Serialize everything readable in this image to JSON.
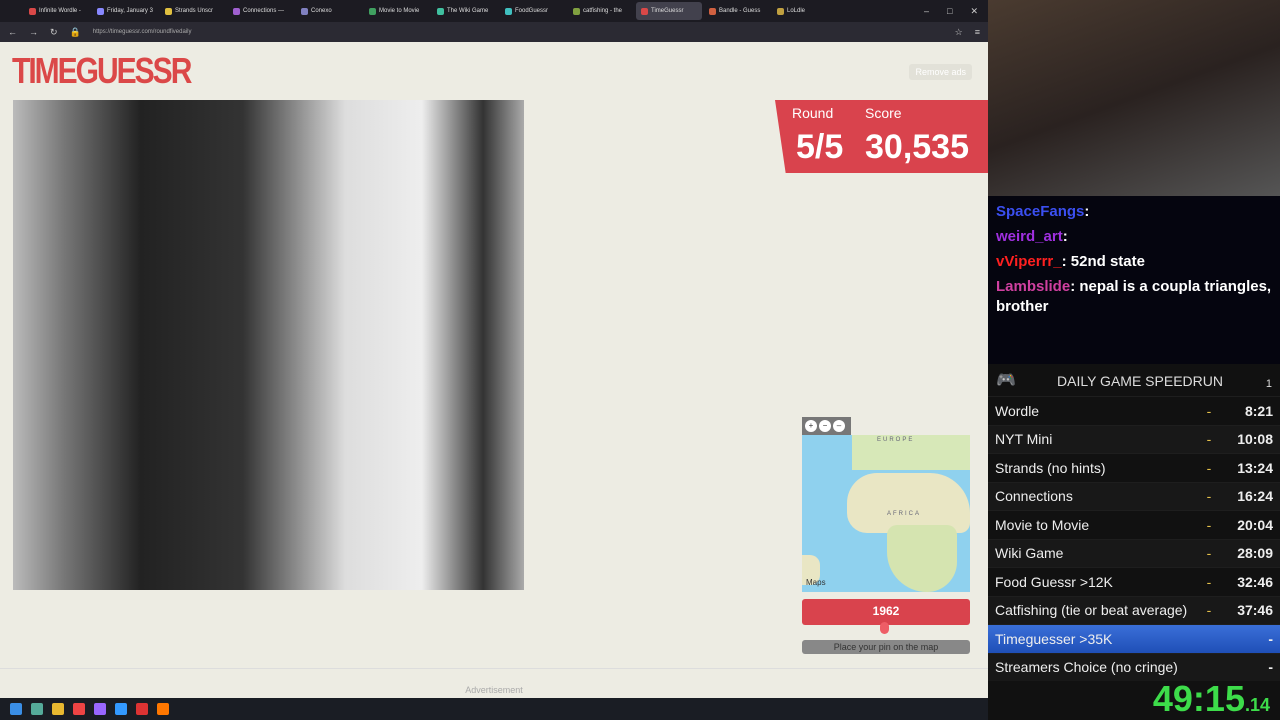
{
  "browser": {
    "tabs": [
      {
        "label": "Infinite Wordle -",
        "color": "#d94848"
      },
      {
        "label": "Friday, January 3",
        "color": "#8888ff"
      },
      {
        "label": "Strands Unscr",
        "color": "#e0c040"
      },
      {
        "label": "Connections —",
        "color": "#a060d0"
      },
      {
        "label": "Conexo",
        "color": "#8080c0"
      },
      {
        "label": "Movie to Movie",
        "color": "#40a060"
      },
      {
        "label": "The Wiki Game",
        "color": "#40c0a0"
      },
      {
        "label": "FoodGuessr",
        "color": "#40c0c0"
      },
      {
        "label": "catfishing - the",
        "color": "#80a040"
      },
      {
        "label": "TimeGuessr",
        "color": "#d94848",
        "active": true
      },
      {
        "label": "Bandle - Guess",
        "color": "#d06040"
      },
      {
        "label": "LoLdle",
        "color": "#c0a040"
      }
    ],
    "url": "https://timeguessr.com/roundfivedaily"
  },
  "page": {
    "logo": "TIMEGUESSR",
    "remove_ads": "Remove ads",
    "round_label": "Round",
    "round_value": "5/5",
    "score_label": "Score",
    "score_value": "30,535",
    "map_labels": {
      "europe": "EUROPE",
      "africa": "AFRICA",
      "attribution": "Maps"
    },
    "year": "1962",
    "place_pin": "Place your pin on the map",
    "advertisement": "Advertisement",
    "accent": "#d9434d"
  },
  "chat": [
    {
      "user": "SpaceFangs",
      "color": "#3b4ff0",
      "message": ""
    },
    {
      "user": "weird_art",
      "color": "#a030e0",
      "message": ""
    },
    {
      "user": "vViperrr_",
      "color": "#ff2020",
      "message": "52nd state"
    },
    {
      "user": "Lambslide",
      "color": "#d040a0",
      "message": "nepal is a coupla triangles, brother"
    }
  ],
  "splits": {
    "title": "DAILY GAME SPEEDRUN",
    "attempts": "1",
    "rows": [
      {
        "name": "Wordle",
        "delta": "-",
        "time": "8:21"
      },
      {
        "name": "NYT Mini",
        "delta": "-",
        "time": "10:08"
      },
      {
        "name": "Strands (no hints)",
        "delta": "-",
        "time": "13:24"
      },
      {
        "name": "Connections",
        "delta": "-",
        "time": "16:24"
      },
      {
        "name": "Movie to Movie",
        "delta": "-",
        "time": "20:04"
      },
      {
        "name": "Wiki Game",
        "delta": "-",
        "time": "28:09"
      },
      {
        "name": "Food Guessr >12K",
        "delta": "-",
        "time": "32:46"
      },
      {
        "name": "Catfishing (tie or beat average)",
        "delta": "-",
        "time": "37:46"
      },
      {
        "name": "Timeguesser >35K",
        "delta": "",
        "time": "-",
        "current": true
      },
      {
        "name": "Streamers Choice (no cringe)",
        "delta": "",
        "time": "-"
      }
    ],
    "timer_main": "49:15",
    "timer_ms": ".14"
  }
}
